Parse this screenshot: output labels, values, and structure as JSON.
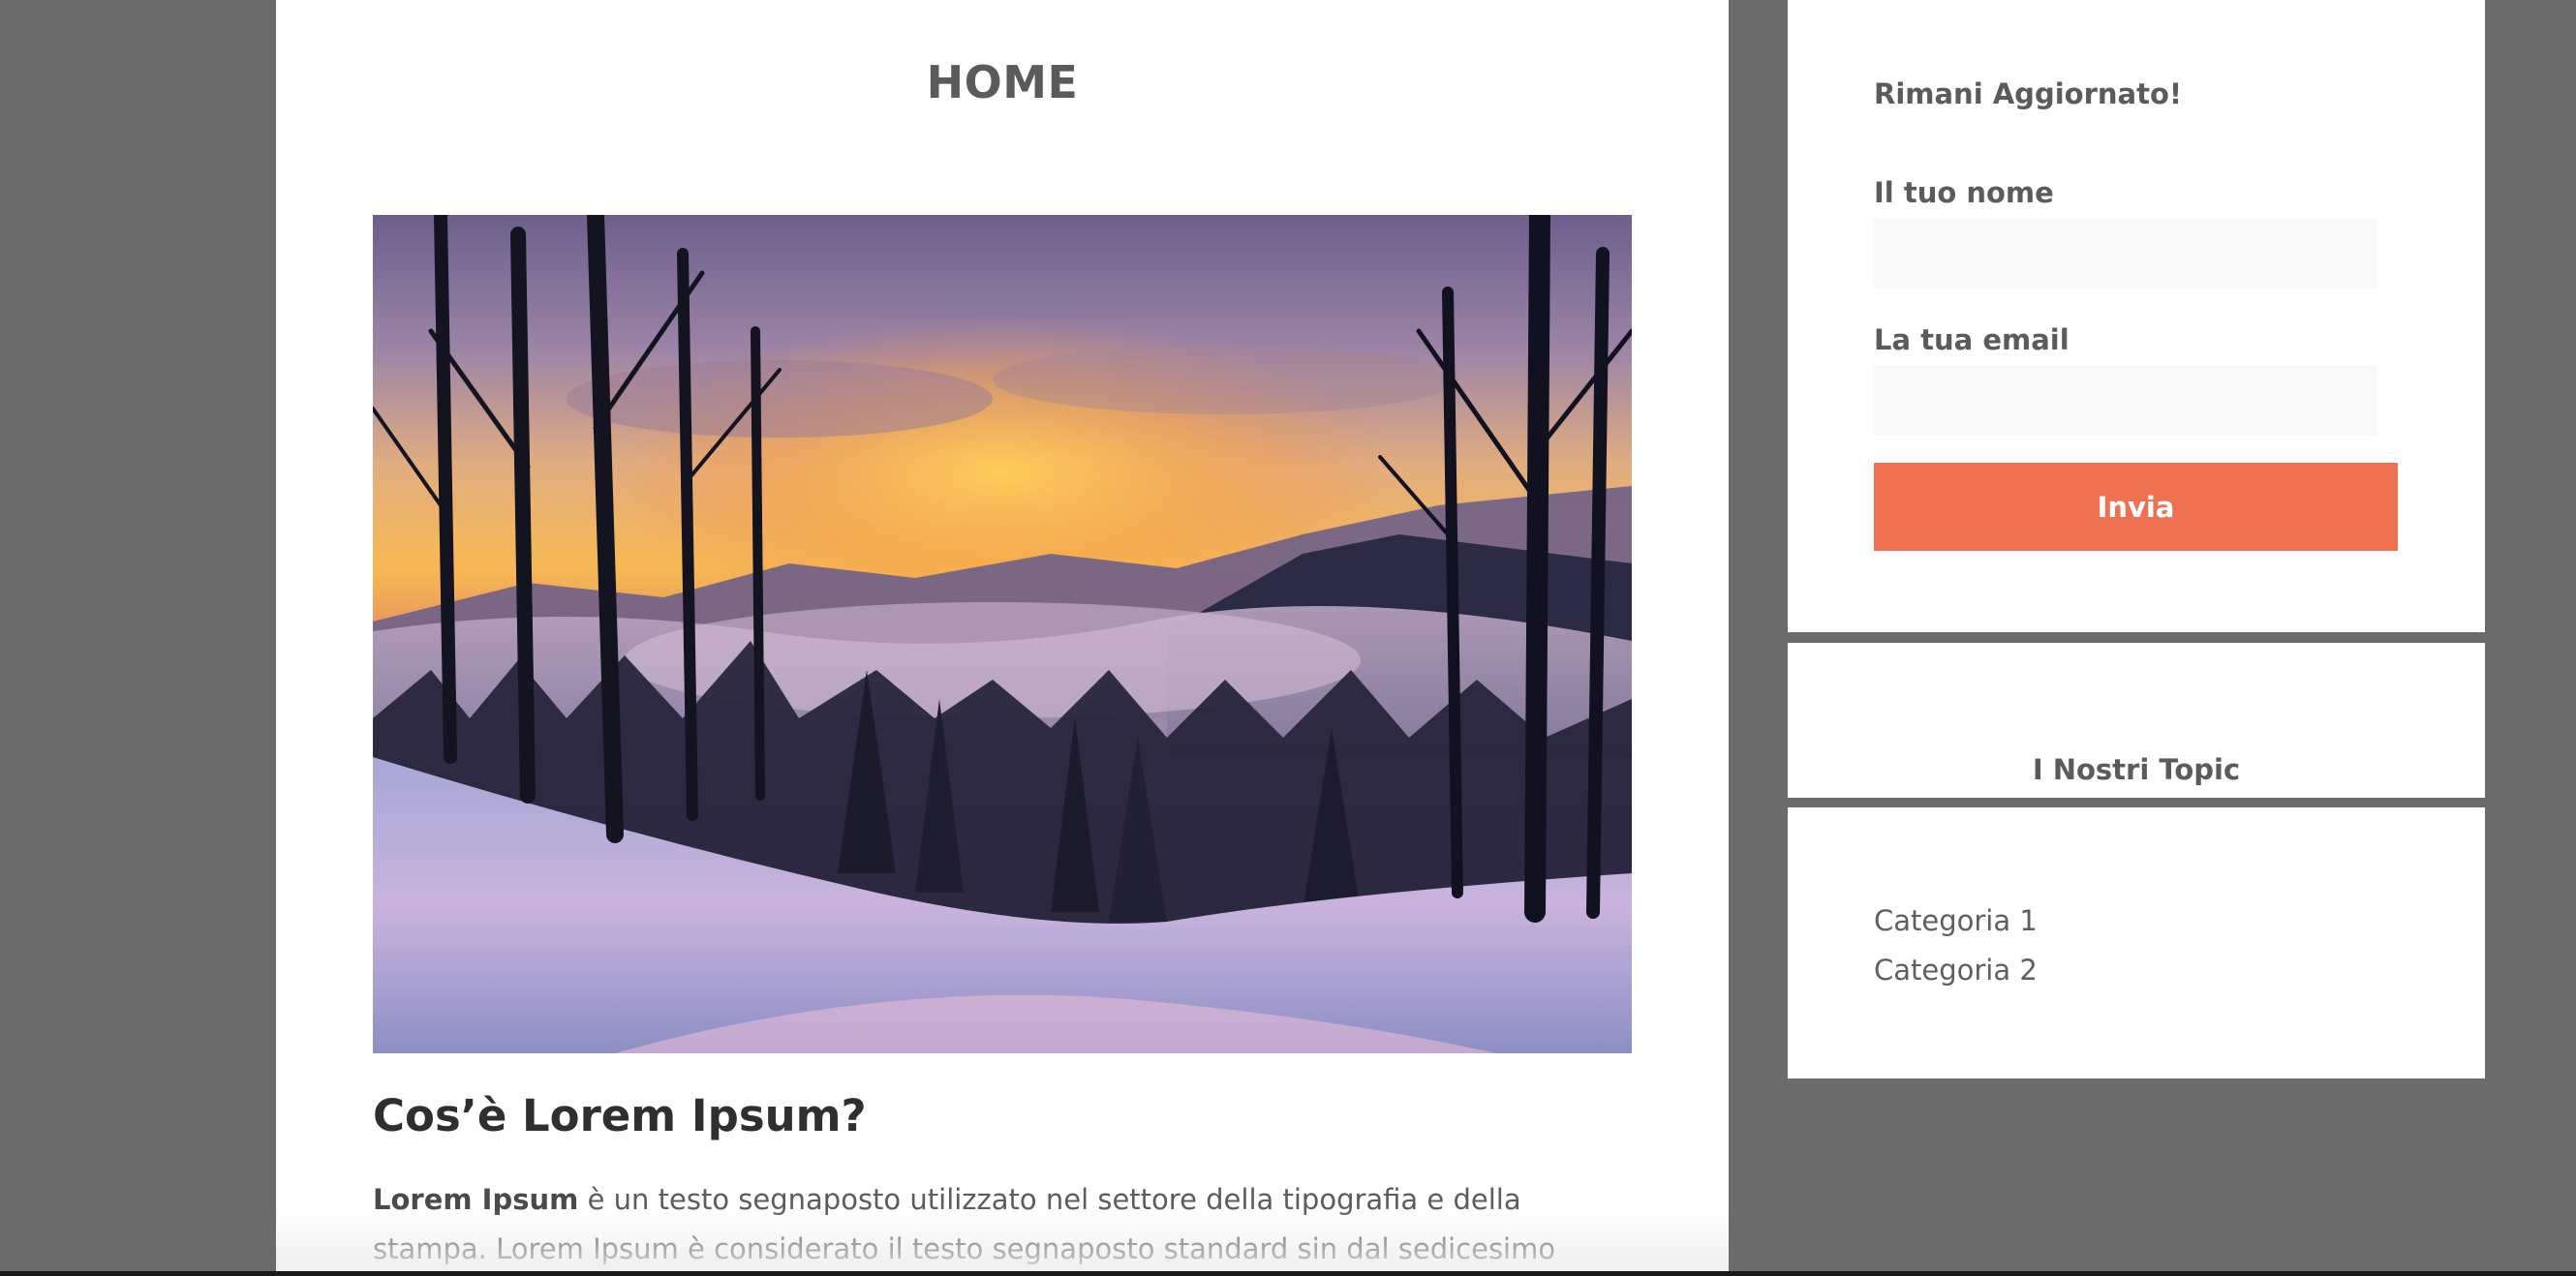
{
  "page": {
    "title": "HOME"
  },
  "article": {
    "hero_alt": "Winter forest sunset landscape",
    "heading": "Cos’è Lorem Ipsum?",
    "lead_bold": "Lorem Ipsum",
    "lead_rest": " è un testo segnaposto utilizzato nel settore della tipografia e della stampa. Lorem Ipsum è considerato il testo segnaposto standard sin dal sedicesimo secolo, quando"
  },
  "sidebar": {
    "newsletter": {
      "title": "Rimani Aggiornato!",
      "name_label": "Il tuo nome",
      "name_value": "",
      "email_label": "La tua email",
      "email_value": "",
      "submit_label": "Invia"
    },
    "topics": {
      "title": "I Nostri Topic",
      "items": [
        {
          "label": "Categoria 1"
        },
        {
          "label": "Categoria 2"
        }
      ]
    }
  },
  "colors": {
    "page_background": "#6b6b6b",
    "card_background": "#ffffff",
    "accent": "#ee7152",
    "text": "#5b5b5b"
  }
}
